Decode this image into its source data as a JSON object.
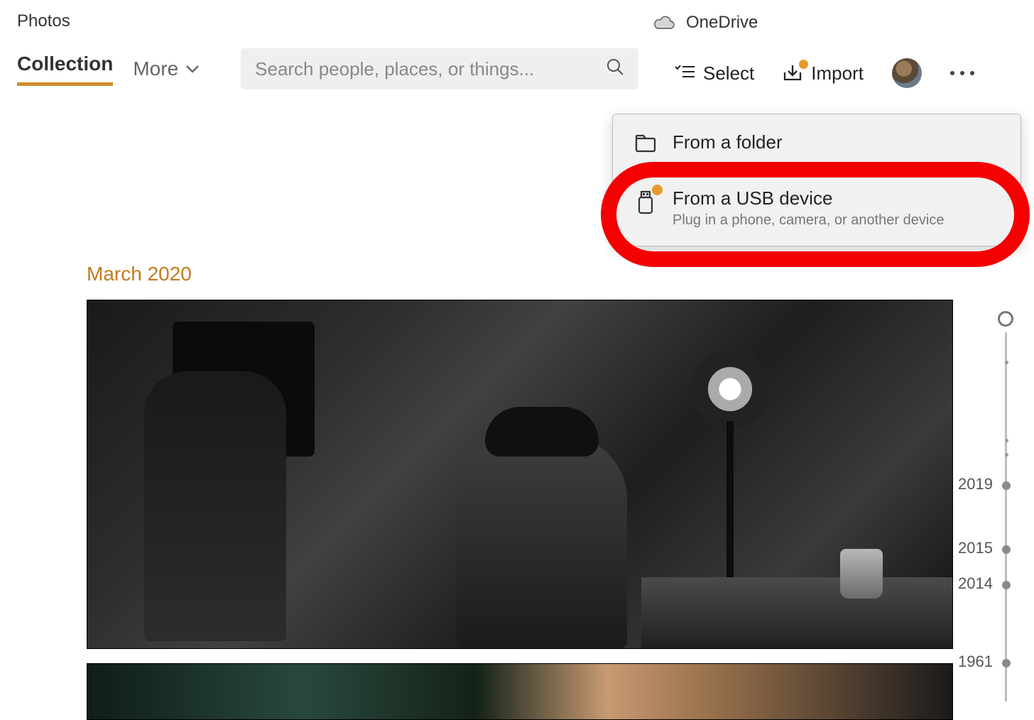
{
  "app": {
    "title": "Photos"
  },
  "onedrive": {
    "label": "OneDrive"
  },
  "nav": {
    "tabs": [
      {
        "label": "Collection",
        "active": true
      },
      {
        "label": "More",
        "active": false
      }
    ]
  },
  "search": {
    "placeholder": "Search people, places, or things..."
  },
  "toolbar": {
    "select_label": "Select",
    "import_label": "Import"
  },
  "import_menu": {
    "items": [
      {
        "title": "From a folder",
        "subtitle": "",
        "icon": "folder-icon",
        "badge": false
      },
      {
        "title": "From a USB device",
        "subtitle": "Plug in a phone, camera, or another device",
        "icon": "usb-icon",
        "badge": true,
        "highlighted": true
      }
    ]
  },
  "collection": {
    "date_heading": "March 2020"
  },
  "timeline": {
    "years": [
      "2019",
      "2015",
      "2014",
      "1961"
    ]
  }
}
